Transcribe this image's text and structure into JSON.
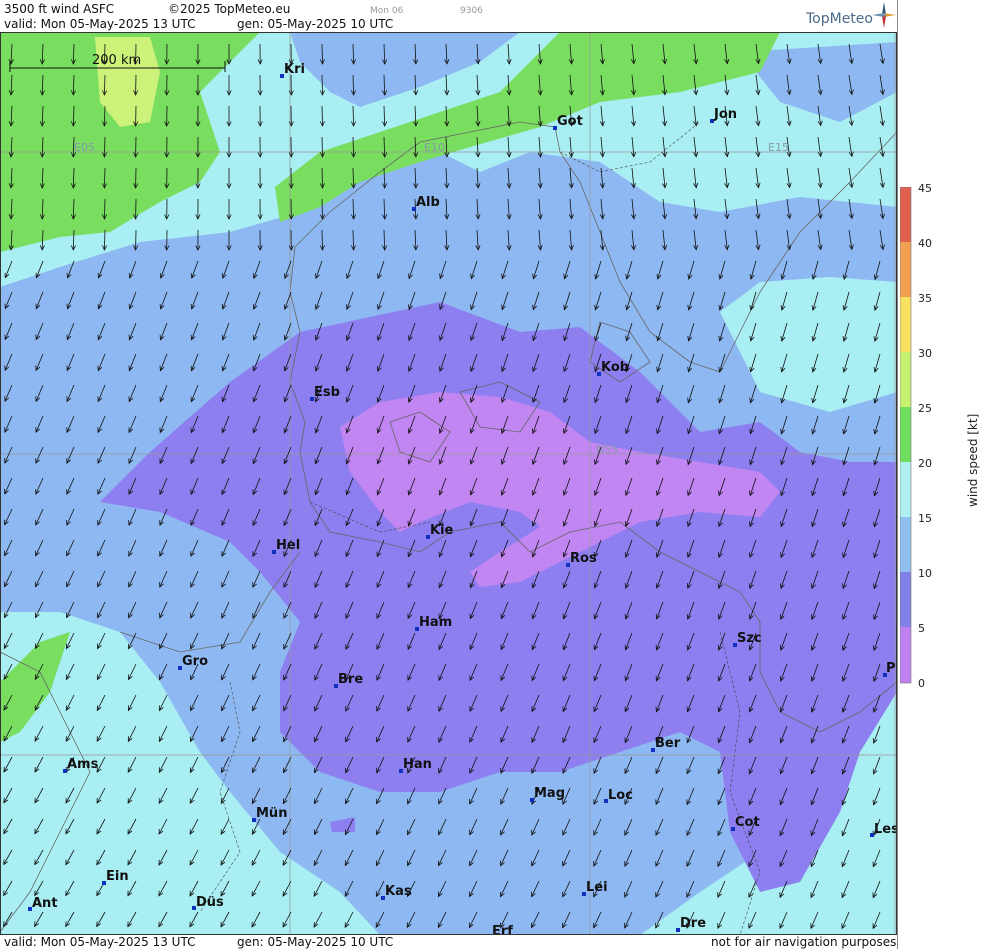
{
  "header": {
    "product": "3500 ft wind ASFC",
    "copyright": "©2025 TopMeteo.eu",
    "day_tab": "Mon 06",
    "code": "9306",
    "valid": "valid:  Mon  05-May-2025  13 UTC",
    "generated": "gen: 05-May-2025 10 UTC",
    "logo": "TopMeteo"
  },
  "footer": {
    "valid": "valid:  Mon  05-May-2025  13 UTC",
    "generated": "gen: 05-May-2025 10 UTC",
    "disclaimer": "not for air navigation purposes"
  },
  "scale_bar": "200 km",
  "grid_labels": [
    "E05",
    "E10",
    "E15",
    "N55"
  ],
  "cities": [
    "Kri",
    "Got",
    "Jon",
    "Alb",
    "Kob",
    "Esb",
    "Kie",
    "Hel",
    "Ros",
    "Ham",
    "Szc",
    "Gro",
    "Bre",
    "Pi",
    "Ber",
    "Ams",
    "Han",
    "Mag",
    "Loc",
    "Mün",
    "Cot",
    "Les",
    "Ein",
    "Kas",
    "Lei",
    "Ant",
    "Düs",
    "Dre",
    "Erf"
  ],
  "legend": {
    "unit": "wind speed [kt]",
    "ticks": [
      "45",
      "40",
      "35",
      "30",
      "25",
      "20",
      "15",
      "10",
      "5",
      "0"
    ],
    "colors": [
      "#e06050",
      "#f0a050",
      "#f8e060",
      "#c8f070",
      "#70dd60",
      "#b0f0f0",
      "#90c0f0",
      "#8080e8",
      "#c080f0"
    ]
  },
  "colors": {
    "green": "#79dd5f",
    "yellow_green": "#cdf27a",
    "cyan": "#a8eef2",
    "light_blue": "#8eb8f2",
    "purple": "#8d7ff0",
    "violet": "#c186f2"
  }
}
